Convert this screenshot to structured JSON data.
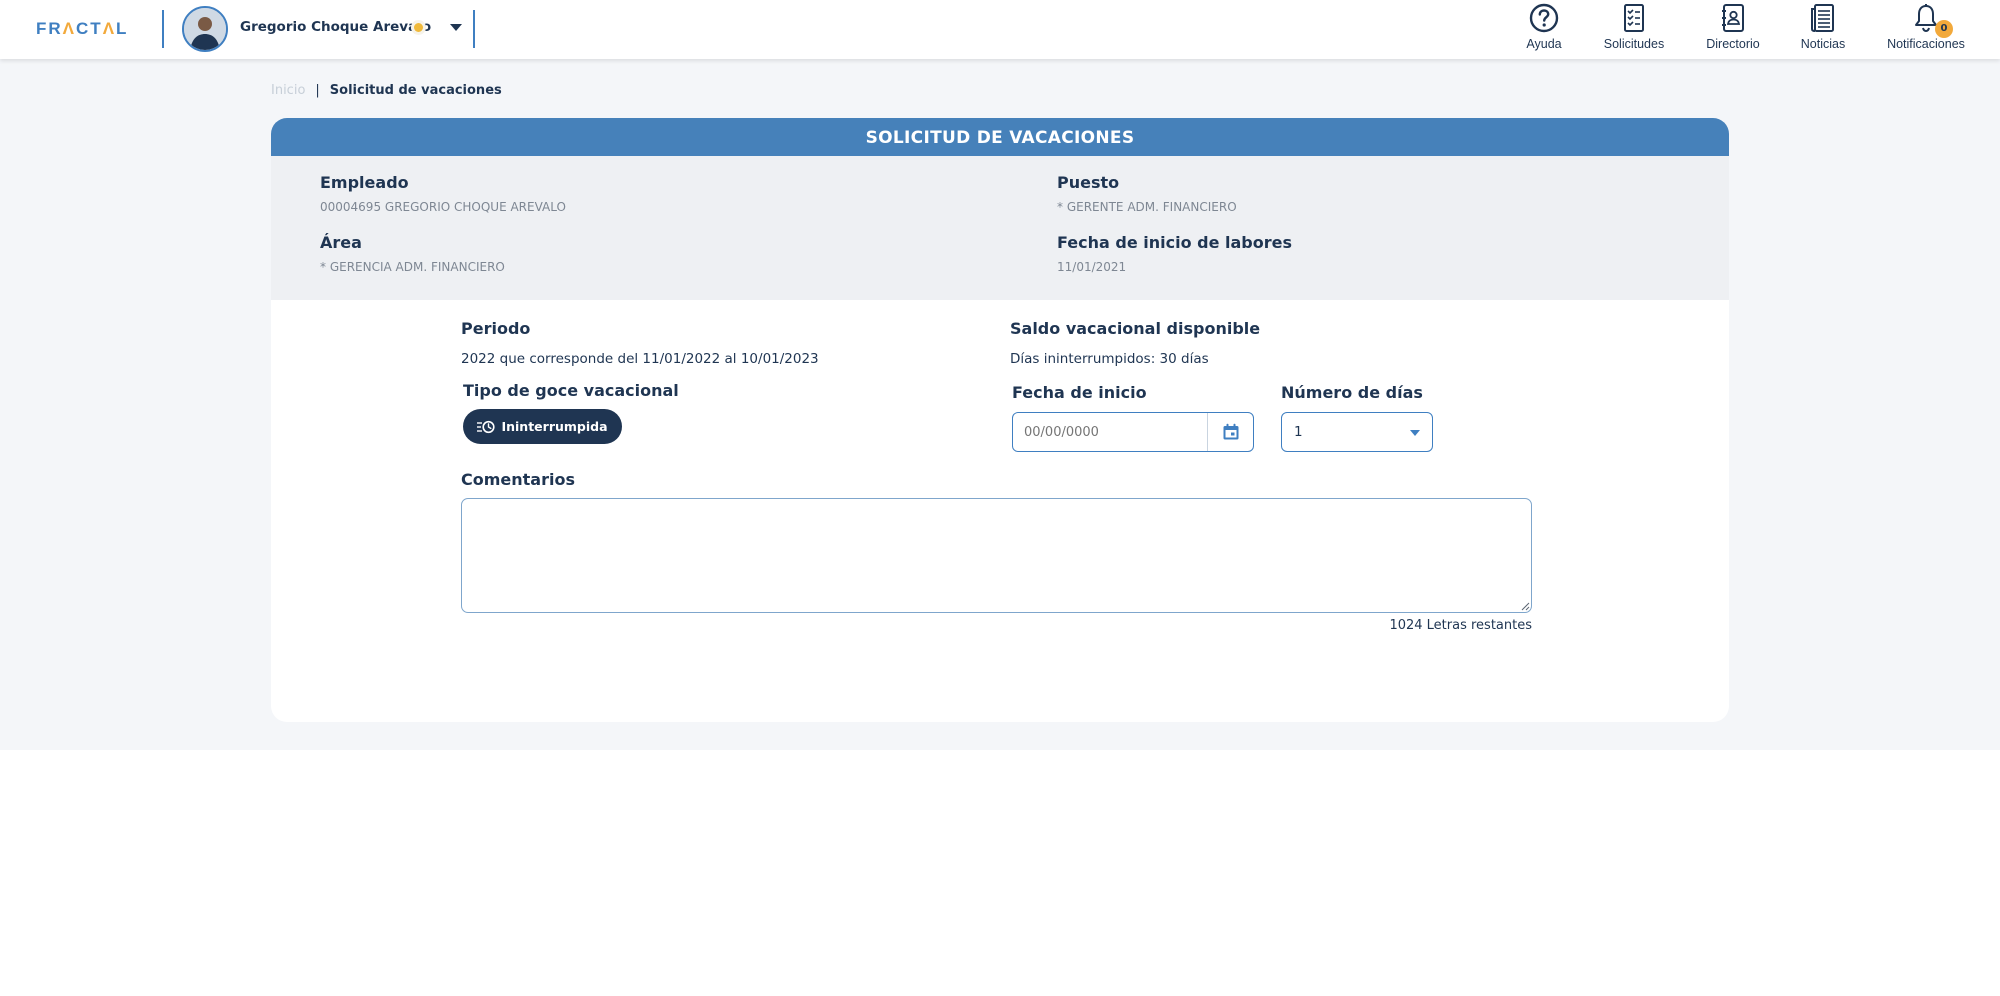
{
  "header": {
    "logo": {
      "pre": "FR",
      "tri": "Λ",
      "mid": "CT",
      "tri2": "Λ",
      "post": "L"
    },
    "user_name": "Gregorio Choque Arevalo",
    "nav": [
      {
        "label": "Ayuda",
        "icon": "help-circle-icon"
      },
      {
        "label": "Solicitudes",
        "icon": "checklist-icon"
      },
      {
        "label": "Directorio",
        "icon": "contact-book-icon"
      },
      {
        "label": "Noticias",
        "icon": "newspaper-icon"
      },
      {
        "label": "Notificaciones",
        "icon": "bell-icon",
        "badge": "0"
      }
    ]
  },
  "breadcrumb": {
    "home": "Inicio",
    "separator": "|",
    "current": "Solicitud de vacaciones"
  },
  "card": {
    "title": "SOLICITUD DE VACACIONES",
    "info": {
      "empleado_label": "Empleado",
      "empleado_value": "00004695 GREGORIO CHOQUE AREVALO",
      "puesto_label": "Puesto",
      "puesto_value": "* GERENTE ADM. FINANCIERO",
      "area_label": "Área",
      "area_value": "* GERENCIA ADM. FINANCIERO",
      "fecha_inicio_labores_label": "Fecha de inicio de labores",
      "fecha_inicio_labores_value": "11/01/2021"
    },
    "form": {
      "periodo_label": "Periodo",
      "periodo_value": "2022 que corresponde del 11/01/2022 al 10/01/2023",
      "saldo_label": "Saldo vacacional disponible",
      "saldo_value": "Días ininterrumpidos: 30 días",
      "tipo_label": "Tipo de goce vacacional",
      "tipo_option": "Ininterrumpida",
      "fecha_inicio_label": "Fecha de inicio",
      "fecha_inicio_placeholder": "00/00/0000",
      "numero_dias_label": "Número de días",
      "numero_dias_value": "1",
      "comentarios_label": "Comentarios",
      "char_remaining": "1024 Letras restantes"
    }
  },
  "colors": {
    "primary": "#4681ba",
    "navy": "#1f3552",
    "accent": "#f2a93b",
    "panel": "#eef0f3",
    "background": "#f4f6f9"
  }
}
